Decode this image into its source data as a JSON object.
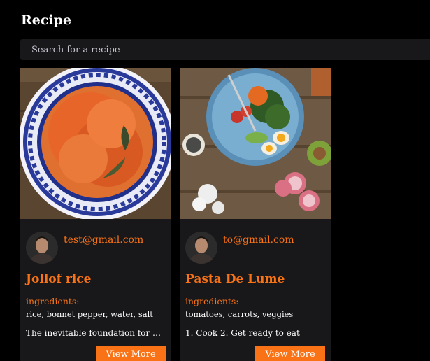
{
  "header": {
    "title": "Recipe"
  },
  "search": {
    "placeholder": "Search for a recipe"
  },
  "colors": {
    "background": "#000000",
    "card": "#18181b",
    "accent": "#f97316",
    "text": "#ffffff"
  },
  "recipes": [
    {
      "author_email": "test@gmail.com",
      "title": "Jollof rice",
      "ingredients_label": "ingredients:",
      "ingredients": "rice, bonnet pepper, water, salt",
      "description": "The inevitable foundation for building a great meal",
      "button_label": "View More",
      "image_icon": "jollof-rice-plate-photo",
      "avatar_icon": "user-avatar-photo"
    },
    {
      "author_email": "to@gmail.com",
      "title": "Pasta De Lume",
      "ingredients_label": "ingredients:",
      "ingredients": "tomatoes, carrots, veggies",
      "description": "1. Cook 2. Get ready to eat",
      "button_label": "View More",
      "image_icon": "salad-bowl-photo",
      "avatar_icon": "user-avatar-photo"
    }
  ]
}
